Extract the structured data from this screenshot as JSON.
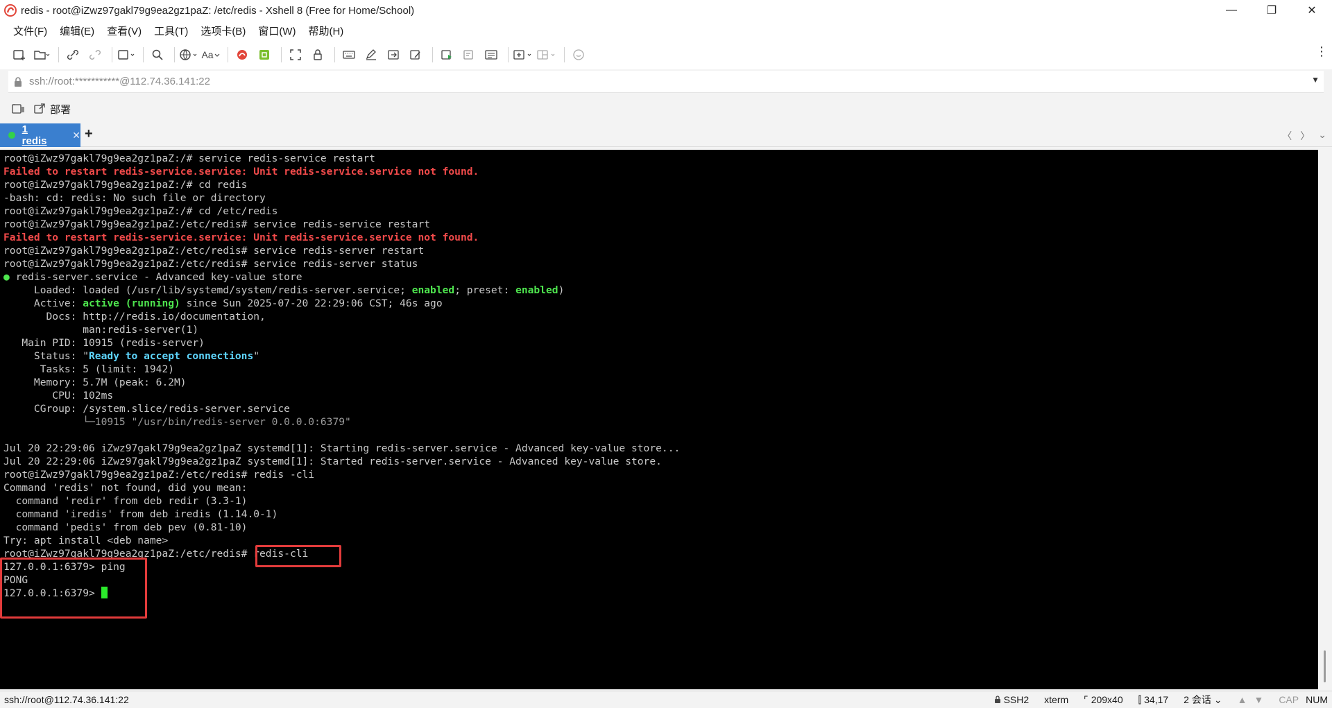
{
  "window": {
    "title": "redis - root@iZwz97gakl79g9ea2gz1paZ: /etc/redis - Xshell 8 (Free for Home/School)",
    "minimize_glyph": "—",
    "restore_glyph": "❐",
    "close_glyph": "✕"
  },
  "menu": [
    "文件(F)",
    "编辑(E)",
    "查看(V)",
    "工具(T)",
    "选项卡(B)",
    "窗口(W)",
    "帮助(H)"
  ],
  "toolbar": {
    "font_label": "Aa",
    "icons": [
      "new-session-icon",
      "open-icon",
      "link-icon",
      "unlink-icon",
      "new-tab-icon",
      "find-icon",
      "globe-icon",
      "font-icon",
      "xftp-icon",
      "xmanager-icon",
      "fullscreen-icon",
      "lock-icon",
      "keyboard-icon",
      "compose-icon",
      "send-icon",
      "script-icon",
      "macro-icon",
      "log-icon",
      "layout-icon",
      "split-icon",
      "chat-icon"
    ]
  },
  "address": {
    "value": "ssh://root:***********@112.74.36.141:22"
  },
  "quick": {
    "deploy_label": "部署"
  },
  "tabs": [
    {
      "label": "1 redis",
      "active": true,
      "status_color": "#33d14a"
    }
  ],
  "terminal": {
    "lines": [
      [
        {
          "t": "root@iZwz97gakl79g9ea2gz1paZ:/# service redis-service restart"
        }
      ],
      [
        {
          "t": "Failed to restart redis-service.service: Unit redis-service.service not found.",
          "c": "red"
        }
      ],
      [
        {
          "t": "root@iZwz97gakl79g9ea2gz1paZ:/# cd redis"
        }
      ],
      [
        {
          "t": "-bash: cd: redis: No such file or directory"
        }
      ],
      [
        {
          "t": "root@iZwz97gakl79g9ea2gz1paZ:/# cd /etc/redis"
        }
      ],
      [
        {
          "t": "root@iZwz97gakl79g9ea2gz1paZ:/etc/redis# service redis-service restart"
        }
      ],
      [
        {
          "t": "Failed to restart redis-service.service: Unit redis-service.service not found.",
          "c": "red"
        }
      ],
      [
        {
          "t": "root@iZwz97gakl79g9ea2gz1paZ:/etc/redis# service redis-server restart"
        }
      ],
      [
        {
          "t": "root@iZwz97gakl79g9ea2gz1paZ:/etc/redis# service redis-server status"
        }
      ],
      [
        {
          "t": "●",
          "c": "green"
        },
        {
          "t": " redis-server.service - Advanced key-value store"
        }
      ],
      [
        {
          "t": "     Loaded: loaded (/usr/lib/systemd/system/redis-server.service; "
        },
        {
          "t": "enabled",
          "c": "green"
        },
        {
          "t": "; preset: "
        },
        {
          "t": "enabled",
          "c": "green"
        },
        {
          "t": ")"
        }
      ],
      [
        {
          "t": "     Active: "
        },
        {
          "t": "active (running)",
          "c": "green"
        },
        {
          "t": " since Sun 2025-07-20 22:29:06 CST; 46s ago"
        }
      ],
      [
        {
          "t": "       Docs: http://redis.io/documentation,"
        }
      ],
      [
        {
          "t": "             man:redis-server(1)"
        }
      ],
      [
        {
          "t": "   Main PID: 10915 (redis-server)"
        }
      ],
      [
        {
          "t": "     Status: \""
        },
        {
          "t": "Ready to accept connections",
          "c": "cyan"
        },
        {
          "t": "\""
        }
      ],
      [
        {
          "t": "      Tasks: 5 (limit: 1942)"
        }
      ],
      [
        {
          "t": "     Memory: 5.7M (peak: 6.2M)"
        }
      ],
      [
        {
          "t": "        CPU: 102ms"
        }
      ],
      [
        {
          "t": "     CGroup: /system.slice/redis-server.service"
        }
      ],
      [
        {
          "t": "             └─10915 \"/usr/bin/redis-server 0.0.0.0:6379\"",
          "c": "gray"
        }
      ],
      [
        {
          "t": ""
        }
      ],
      [
        {
          "t": "Jul 20 22:29:06 iZwz97gakl79g9ea2gz1paZ systemd[1]: Starting redis-server.service - Advanced key-value store..."
        }
      ],
      [
        {
          "t": "Jul 20 22:29:06 iZwz97gakl79g9ea2gz1paZ systemd[1]: Started redis-server.service - Advanced key-value store."
        }
      ],
      [
        {
          "t": "root@iZwz97gakl79g9ea2gz1paZ:/etc/redis# redis -cli"
        }
      ],
      [
        {
          "t": "Command 'redis' not found, did you mean:"
        }
      ],
      [
        {
          "t": "  command 'redir' from deb redir (3.3-1)"
        }
      ],
      [
        {
          "t": "  command 'iredis' from deb iredis (1.14.0-1)"
        }
      ],
      [
        {
          "t": "  command 'pedis' from deb pev (0.81-10)"
        }
      ],
      [
        {
          "t": "Try: apt install <deb name>"
        }
      ],
      [
        {
          "t": "root@iZwz97gakl79g9ea2gz1paZ:/etc/redis# redis-cli"
        }
      ],
      [
        {
          "t": "127.0.0.1:6379> ping"
        }
      ],
      [
        {
          "t": "PONG"
        }
      ],
      [
        {
          "t": "127.0.0.1:6379> "
        },
        {
          "cursor": true
        }
      ]
    ]
  },
  "status": {
    "connection": "ssh://root@112.74.36.141:22",
    "protocol": "SSH2",
    "term_type": "xterm",
    "size": "209x40",
    "cursor_pos": "34,17",
    "sessions": "2 会话",
    "cap": "CAP",
    "num": "NUM"
  },
  "colors": {
    "tab_active": "#3a7fcf",
    "highlight": "#e23b3b",
    "cursor": "#2bea2b"
  }
}
